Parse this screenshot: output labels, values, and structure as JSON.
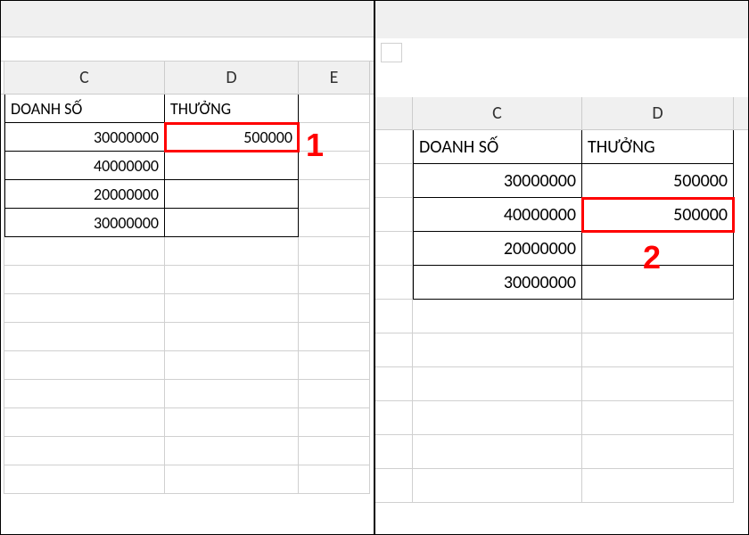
{
  "left": {
    "columns": {
      "c": "C",
      "d": "D",
      "e": "E"
    },
    "headers": {
      "c": "DOANH SỐ",
      "d": "THƯỞNG"
    },
    "rows": [
      {
        "c": "30000000",
        "d": "500000"
      },
      {
        "c": "40000000",
        "d": ""
      },
      {
        "c": "20000000",
        "d": ""
      },
      {
        "c": "30000000",
        "d": ""
      }
    ],
    "annotation": "1"
  },
  "right": {
    "columns": {
      "c": "C",
      "d": "D"
    },
    "headers": {
      "c": "DOANH SỐ",
      "d": "THƯỞNG"
    },
    "rows": [
      {
        "c": "30000000",
        "d": "500000"
      },
      {
        "c": "40000000",
        "d": "500000"
      },
      {
        "c": "20000000",
        "d": ""
      },
      {
        "c": "30000000",
        "d": ""
      }
    ],
    "annotation": "2"
  }
}
